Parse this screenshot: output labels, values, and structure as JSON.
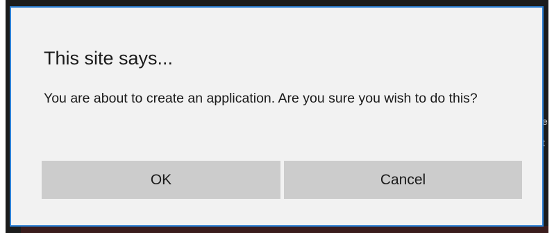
{
  "dialog": {
    "title": "This site says...",
    "message": "You are about to create an application. Are you sure you wish to do this?",
    "ok_label": "OK",
    "cancel_label": "Cancel"
  },
  "background": {
    "edge_glyphs": [
      "e",
      "t"
    ]
  },
  "colors": {
    "dialog_border": "#2b7fd4",
    "dialog_background": "#f2f2f2",
    "button_background": "#cccccc"
  }
}
